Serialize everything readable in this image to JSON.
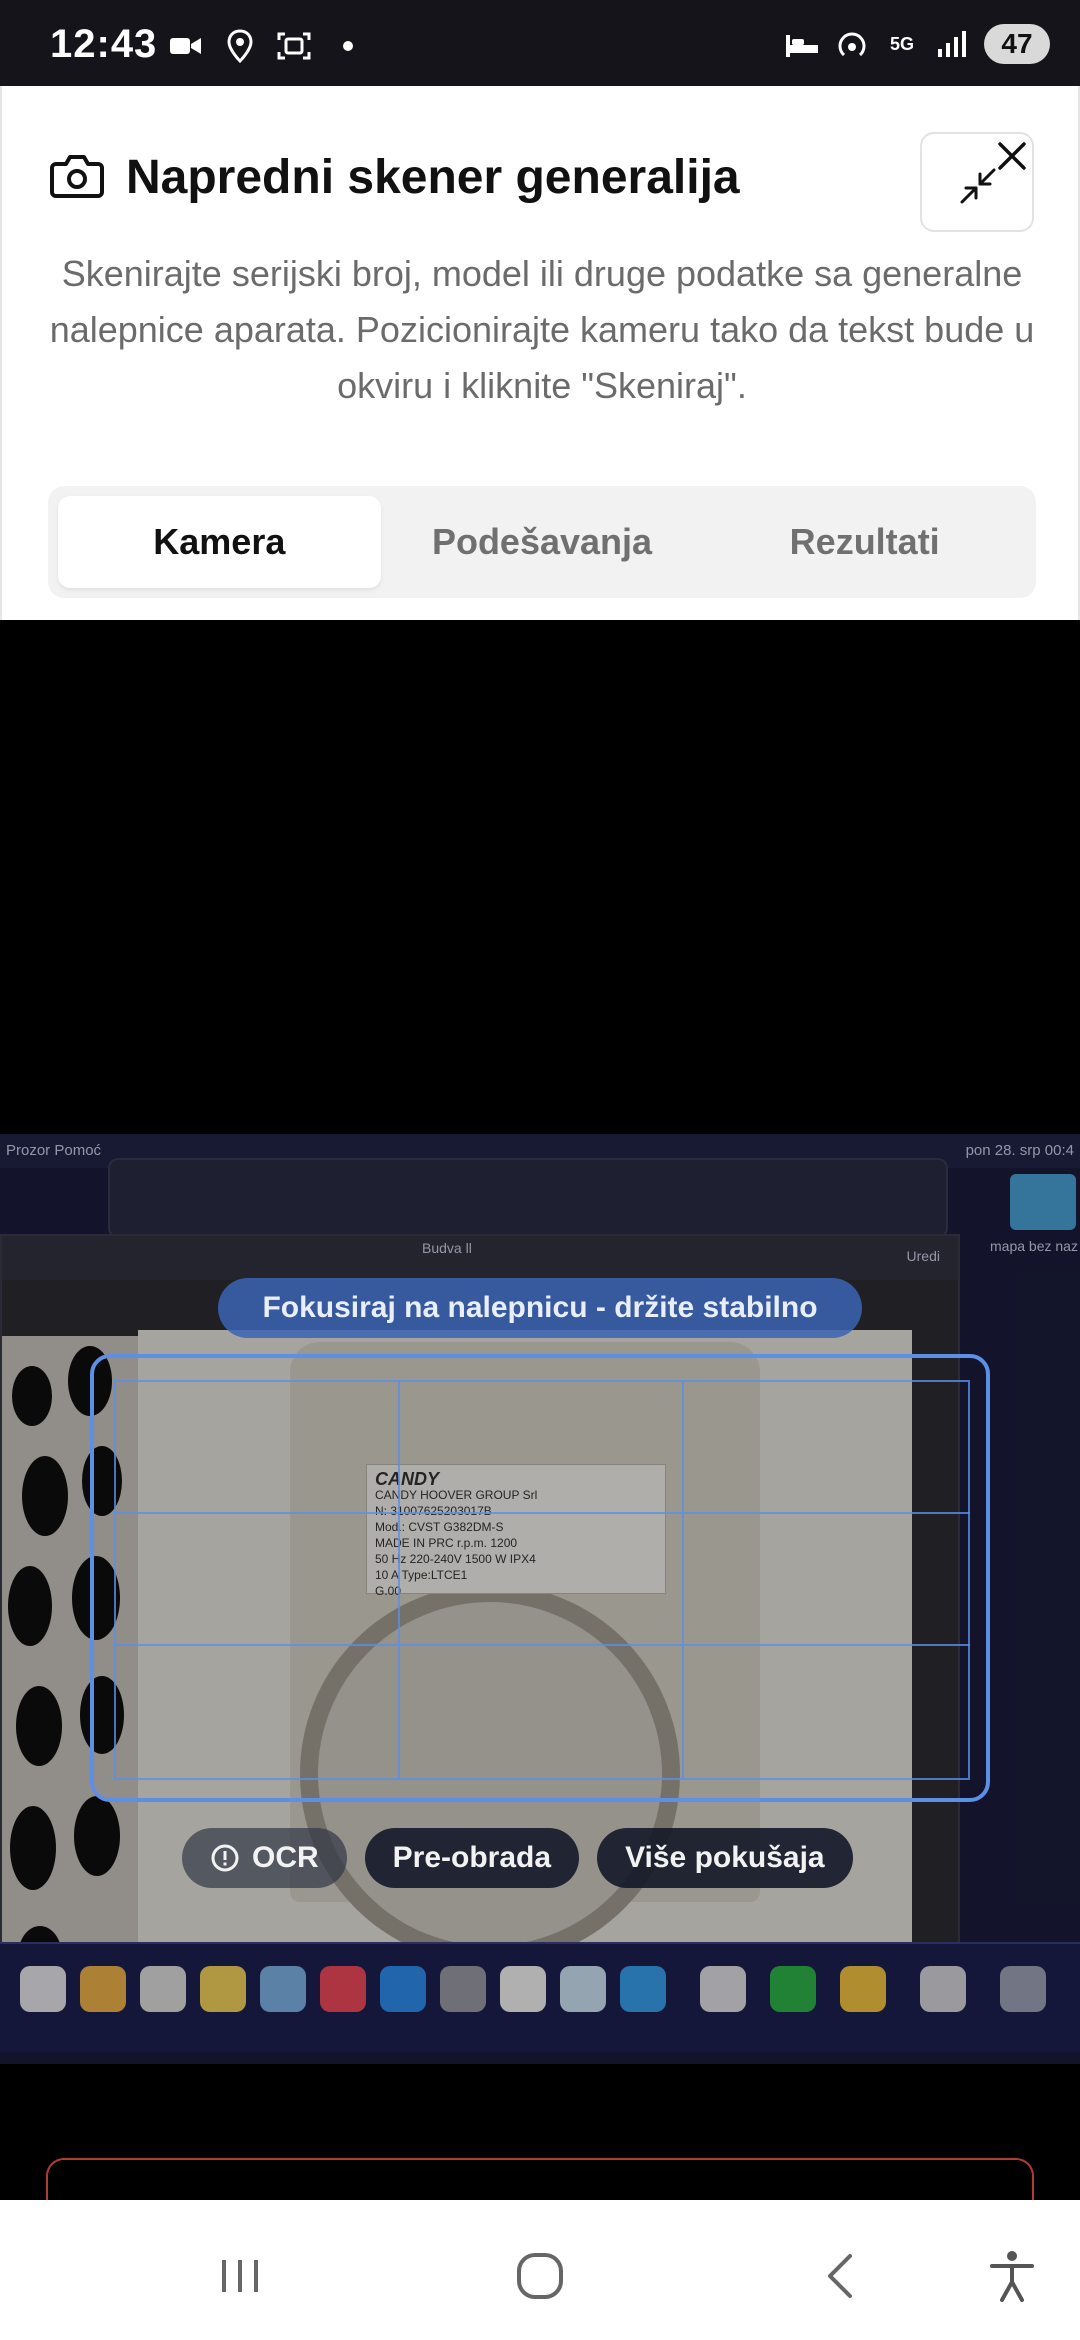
{
  "status_bar": {
    "time": "12:43",
    "left_icons": [
      "video-call-icon",
      "location-icon",
      "screenshot-icon",
      "dot-icon"
    ],
    "right_icons": [
      "sleep-mode-icon",
      "hotspot-icon",
      "5g-icon",
      "signal-icon"
    ],
    "network_label": "5G",
    "battery": "47"
  },
  "modal": {
    "title": "Napredni skener generalija",
    "subtitle": "Skenirajte serijski broj, model ili druge podatke sa generalne nalepnice aparata. Pozicionirajte kameru tako da tekst bude u okviru i kliknite \"Skeniraj\".",
    "tabs": [
      {
        "label": "Kamera",
        "active": true
      },
      {
        "label": "Podešavanja",
        "active": false
      },
      {
        "label": "Rezultati",
        "active": false
      }
    ]
  },
  "camera": {
    "hint": "Fokusiraj na nalepnicu - držite stabilno",
    "chips": [
      {
        "label": "OCR",
        "icon": "alert-circle-icon"
      },
      {
        "label": "Pre-obrada"
      },
      {
        "label": "Više pokušaja"
      }
    ],
    "preview": {
      "menu_left": "Prozor   Pomoć",
      "menu_right": "pon 28. srp  00:4",
      "folder_label": "mapa bez naz",
      "window_title": "Budva ll",
      "window_action": "Uredi",
      "sticker_lines": [
        "CANDY",
        "CANDY HOOVER GROUP Srl",
        "N: 31007625203017B",
        "Mod.: CVST G382DM-S",
        "MADE IN PRC  r.p.m. 1200",
        "50 Hz  220-240V  1500 W IPX4",
        "10 A  Type:LTCE1",
        "G.00"
      ]
    }
  },
  "nav_bar": {
    "buttons": [
      "recent-apps-icon",
      "home-icon",
      "back-icon",
      "accessibility-icon"
    ]
  },
  "colors": {
    "accent": "#5d8fe6",
    "status_bar_bg": "#14141a",
    "hint_bg": "#3c64b4",
    "danger_border": "#b43b2f"
  }
}
